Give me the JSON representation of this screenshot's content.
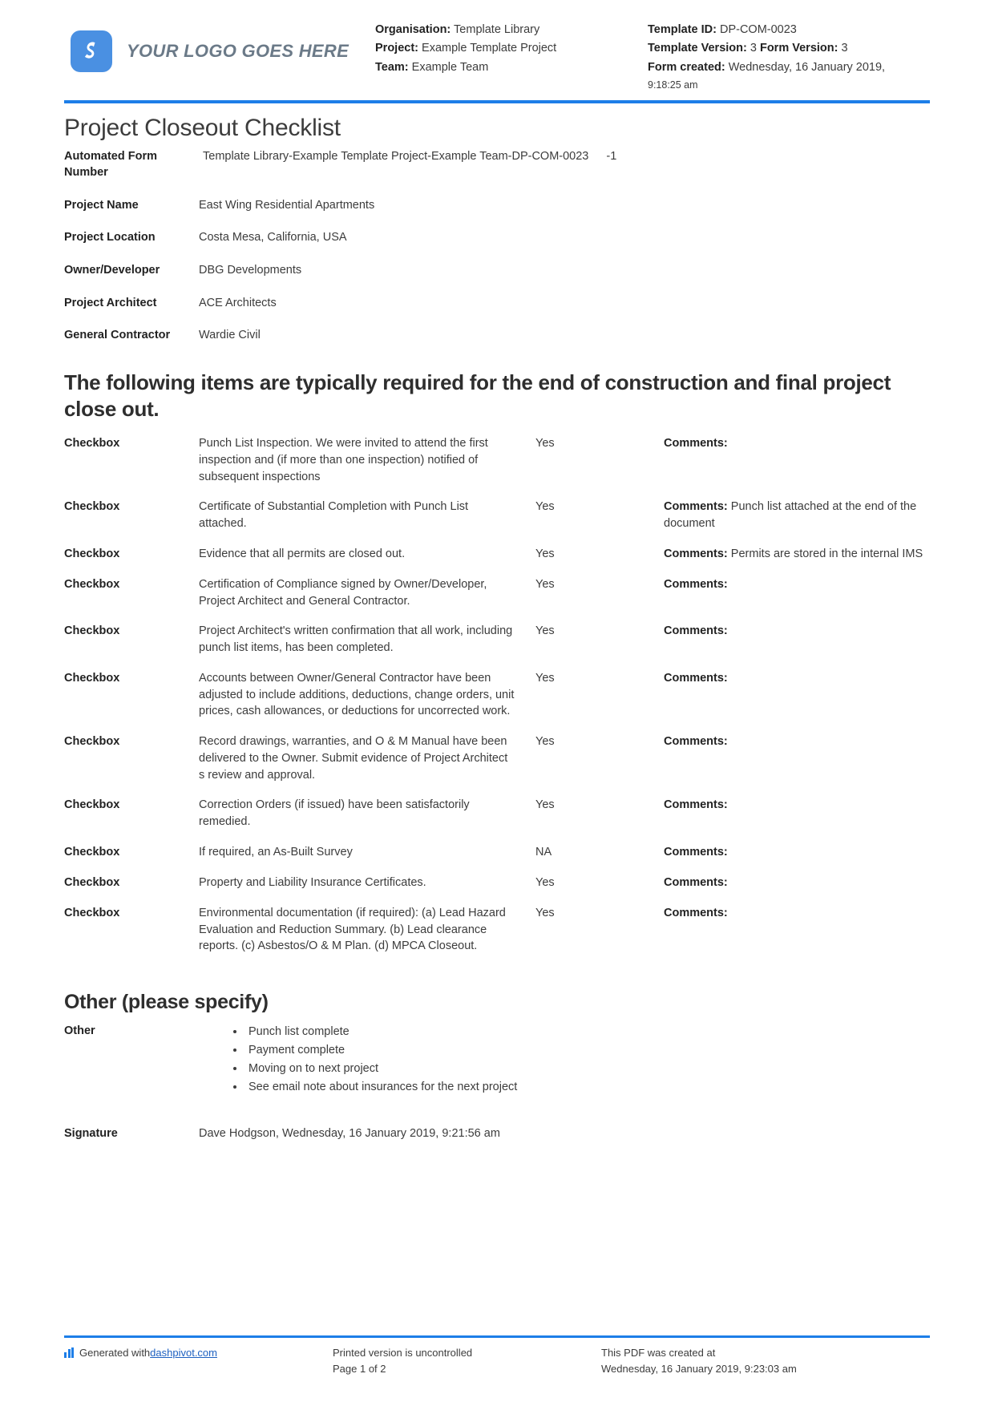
{
  "brand": {
    "accent_color": "#1d7ee8",
    "logo_text": "YOUR LOGO GOES HERE"
  },
  "header": {
    "left": {
      "organisation_label": "Organisation:",
      "organisation_value": "Template Library",
      "project_label": "Project:",
      "project_value": "Example Template Project",
      "team_label": "Team:",
      "team_value": "Example Team"
    },
    "right": {
      "template_id_label": "Template ID:",
      "template_id_value": "DP-COM-0023",
      "template_version_label": "Template Version:",
      "template_version_value": "3",
      "form_version_label": "Form Version:",
      "form_version_value": "3",
      "form_created_label": "Form created:",
      "form_created_value": "Wednesday, 16 January 2019,",
      "form_created_time": "9:18:25 am"
    }
  },
  "document": {
    "title": "Project Closeout Checklist",
    "fields": [
      {
        "label": "Automated Form Number",
        "value": "Template Library-Example Template Project-Example Team-DP-COM-0023",
        "suffix": "-1"
      },
      {
        "label": "Project Name",
        "value": "East Wing Residential Apartments"
      },
      {
        "label": "Project Location",
        "value": "Costa Mesa, California, USA"
      },
      {
        "label": "Owner/Developer",
        "value": "DBG Developments"
      },
      {
        "label": "Project Architect",
        "value": "ACE Architects"
      },
      {
        "label": "General Contractor",
        "value": "Wardie Civil"
      }
    ],
    "section_heading": "The following items are typically required for the end of construction and final project close out.",
    "checklist": [
      {
        "type": "Checkbox",
        "description": "Punch List Inspection. We were invited to attend the first inspection and (if more than one inspection) notified of subsequent inspections",
        "answer": "Yes",
        "comments_label": "Comments:",
        "comments_value": ""
      },
      {
        "type": "Checkbox",
        "description": "Certificate of Substantial Completion with Punch List attached.",
        "answer": "Yes",
        "comments_label": "Comments:",
        "comments_value": "Punch list attached at the end of the document"
      },
      {
        "type": "Checkbox",
        "description": "Evidence that all permits are closed out.",
        "answer": "Yes",
        "comments_label": "Comments:",
        "comments_value": "Permits are stored in the internal IMS"
      },
      {
        "type": "Checkbox",
        "description": "Certification of Compliance signed by Owner/Developer, Project Architect and General Contractor.",
        "answer": "Yes",
        "comments_label": "Comments:",
        "comments_value": ""
      },
      {
        "type": "Checkbox",
        "description": "Project Architect's written confirmation that all work, including punch list items, has been completed.",
        "answer": "Yes",
        "comments_label": "Comments:",
        "comments_value": ""
      },
      {
        "type": "Checkbox",
        "description": "Accounts between Owner/General Contractor have been adjusted to include additions, deductions, change orders, unit prices, cash allowances, or deductions for uncorrected work.",
        "answer": "Yes",
        "comments_label": "Comments:",
        "comments_value": ""
      },
      {
        "type": "Checkbox",
        "description": "Record drawings, warranties, and O & M Manual have been delivered to the Owner. Submit evidence of Project Architect s review and approval.",
        "answer": "Yes",
        "comments_label": "Comments:",
        "comments_value": ""
      },
      {
        "type": "Checkbox",
        "description": "Correction Orders (if issued) have been satisfactorily remedied.",
        "answer": "Yes",
        "comments_label": "Comments:",
        "comments_value": ""
      },
      {
        "type": "Checkbox",
        "description": "If required, an As-Built Survey",
        "answer": "NA",
        "comments_label": "Comments:",
        "comments_value": ""
      },
      {
        "type": "Checkbox",
        "description": "Property and Liability Insurance Certificates.",
        "answer": "Yes",
        "comments_label": "Comments:",
        "comments_value": ""
      },
      {
        "type": "Checkbox",
        "description": "Environmental documentation (if required): (a) Lead Hazard Evaluation and Reduction Summary. (b) Lead clearance reports. (c) Asbestos/O & M Plan. (d) MPCA Closeout.",
        "answer": "Yes",
        "comments_label": "Comments:",
        "comments_value": ""
      }
    ],
    "other_heading": "Other (please specify)",
    "other_label": "Other",
    "other_items": [
      "Punch list complete",
      "Payment complete",
      "Moving on to next project",
      "See email note about insurances for the next project"
    ],
    "signature_label": "Signature",
    "signature_value": "Dave Hodgson, Wednesday, 16 January 2019, 9:21:56 am"
  },
  "footer": {
    "generated_prefix": "Generated with ",
    "generated_link": "dashpivot.com",
    "printed_line1": "Printed version is uncontrolled",
    "printed_line2": "Page 1 of 2",
    "created_line1": "This PDF was created at",
    "created_line2": "Wednesday, 16 January 2019, 9:23:03 am"
  }
}
